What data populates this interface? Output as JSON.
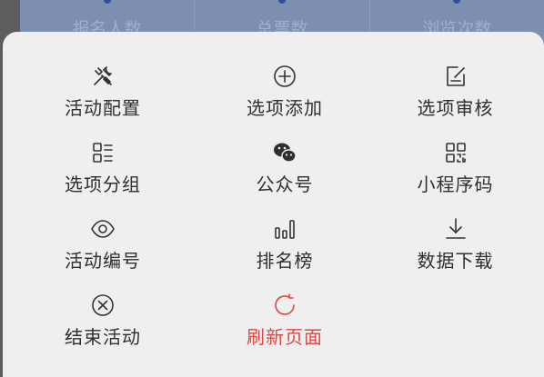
{
  "stats": {
    "items": [
      {
        "label": "报名人数"
      },
      {
        "label": "总票数"
      },
      {
        "label": "浏览次数"
      }
    ]
  },
  "menu": {
    "items": [
      {
        "label": "活动配置",
        "icon": "tools-icon"
      },
      {
        "label": "选项添加",
        "icon": "plus-circle-icon"
      },
      {
        "label": "选项审核",
        "icon": "edit-note-icon"
      },
      {
        "label": "选项分组",
        "icon": "list-group-icon"
      },
      {
        "label": "公众号",
        "icon": "wechat-icon"
      },
      {
        "label": "小程序码",
        "icon": "qr-code-icon"
      },
      {
        "label": "活动编号",
        "icon": "eye-icon"
      },
      {
        "label": "排名榜",
        "icon": "bar-chart-icon"
      },
      {
        "label": "数据下载",
        "icon": "download-icon"
      },
      {
        "label": "结束活动",
        "icon": "close-circle-icon"
      },
      {
        "label": "刷新页面",
        "icon": "refresh-icon",
        "color": "#e2453f"
      }
    ]
  },
  "colors": {
    "overlay": "#5d5d60",
    "sheet": "#efefef",
    "stats_bar": "#7c8fb1",
    "accent_danger": "#e2453f"
  }
}
